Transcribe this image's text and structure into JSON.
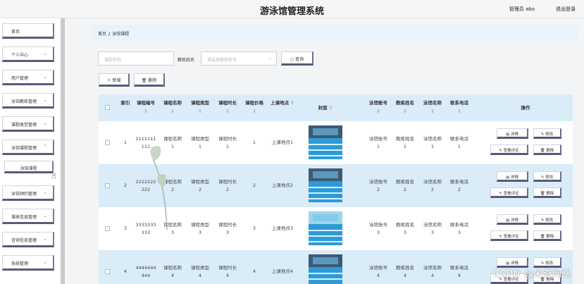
{
  "header": {
    "title": "游泳馆管理系统",
    "user": "管理员 abo",
    "logout": "退出登录"
  },
  "sidebar": {
    "items": [
      {
        "label": "首页",
        "chevron": false
      },
      {
        "label": "个人中心",
        "chevron": true
      },
      {
        "label": "用户管理",
        "chevron": true
      },
      {
        "label": "泳馆教练管理",
        "chevron": true
      },
      {
        "label": "课程类型管理",
        "chevron": true
      },
      {
        "label": "泳馆课程管理",
        "chevron": true
      },
      {
        "label": "泳馆课程",
        "chevron": false
      },
      {
        "label": "泳馆预约管理",
        "chevron": true
      },
      {
        "label": "课表信息管理",
        "chevron": true
      },
      {
        "label": "咨询信息管理",
        "chevron": true
      },
      {
        "label": "系统管理",
        "chevron": true
      }
    ]
  },
  "breadcrumb": {
    "home": "首页",
    "separator": "/",
    "current": "泳馆课程"
  },
  "search": {
    "course_name_placeholder": "课程名称",
    "coach_label": "教练姓名",
    "coach_placeholder": "请选择教练姓名",
    "query_button": "查询"
  },
  "toolbar": {
    "add_button": "新增",
    "delete_button": "删除"
  },
  "table": {
    "headers": [
      "索引",
      "课程编号",
      "课程名称",
      "课程类型",
      "课程时长",
      "课程价格",
      "上课地点",
      "封面",
      "泳馆账号",
      "教练姓名",
      "泳馆名称",
      "联系电话",
      "操作"
    ],
    "rows": [
      {
        "index": "1",
        "code": "1111111111",
        "name": "课程名称1",
        "type": "课程类型1",
        "duration": "课程时长1",
        "price": "1",
        "location": "上课地点1",
        "account": "泳馆账号1",
        "coach": "教练姓名1",
        "venue": "泳馆名称1",
        "phone": "联系电话1"
      },
      {
        "index": "2",
        "code": "2222222222",
        "name": "课程名称2",
        "type": "课程类型2",
        "duration": "课程时长2",
        "price": "2",
        "location": "上课地点2",
        "account": "泳馆账号2",
        "coach": "教练姓名2",
        "venue": "泳馆名称2",
        "phone": "联系电话2"
      },
      {
        "index": "3",
        "code": "3333333333",
        "name": "课程名称3",
        "type": "课程类型3",
        "duration": "课程时长3",
        "price": "3",
        "location": "上课地点3",
        "account": "泳馆账号3",
        "coach": "教练姓名3",
        "venue": "泳馆名称3",
        "phone": "联系电话3"
      },
      {
        "index": "4",
        "code": "4444444444",
        "name": "课程名称4",
        "type": "课程类型4",
        "duration": "课程时长4",
        "price": "4",
        "location": "上课地点4",
        "account": "泳馆账号4",
        "coach": "教练姓名4",
        "venue": "泳馆名称4",
        "phone": "联系电话4"
      }
    ],
    "actions": {
      "detail": "详情",
      "edit": "修改",
      "comments": "查看评论",
      "delete": "删除"
    }
  },
  "watermark": "CSDN @米奇网络",
  "colors": {
    "header_bg": "#f6f6f6",
    "row_blue": "#d9ecf8",
    "button_shadow": "#555a78"
  }
}
